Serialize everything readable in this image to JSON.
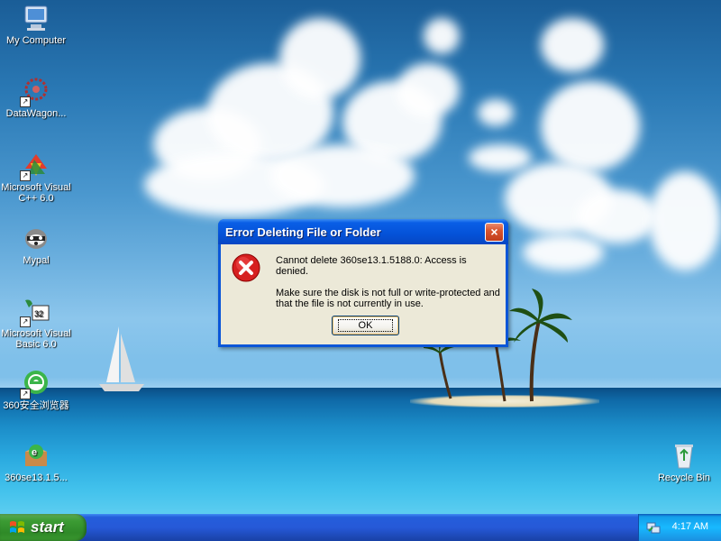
{
  "desktop": {
    "icons": [
      {
        "label": "My Computer",
        "icon": "my-computer-icon"
      },
      {
        "label": "DataWagon...",
        "icon": "datawagon-icon"
      },
      {
        "label": "Microsoft Visual C++ 6.0",
        "icon": "visual-cpp-icon"
      },
      {
        "label": "Mypal",
        "icon": "mypal-icon"
      },
      {
        "label": "Microsoft Visual Basic 6.0",
        "icon": "visual-basic-icon"
      },
      {
        "label": "360安全浏览器",
        "icon": "360-browser-icon"
      },
      {
        "label": "360se13.1.5...",
        "icon": "360se-installer-icon"
      },
      {
        "label": "Recycle Bin",
        "icon": "recycle-bin-icon"
      }
    ]
  },
  "dialog": {
    "title": "Error Deleting File or Folder",
    "close_label": "×",
    "message_line1": "Cannot delete 360se13.1.5188.0: Access is denied.",
    "message_line2": "Make sure the disk is not full or write-protected and that the file is not currently in use.",
    "ok_label": "OK",
    "icon": "error-icon"
  },
  "taskbar": {
    "start_label": "start",
    "clock": "4:17 AM"
  },
  "colors": {
    "titlebar": "#0452d8",
    "dialog_body": "#ece9d8",
    "start_green": "#3c9c34",
    "tray_blue": "#18b9ff"
  }
}
